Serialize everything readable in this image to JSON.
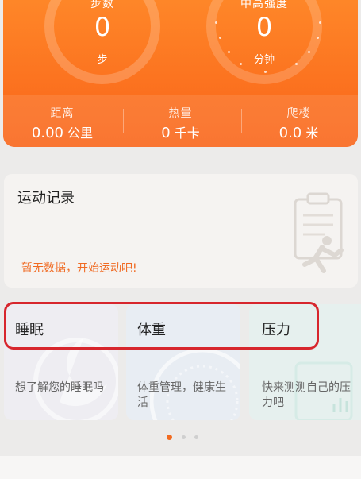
{
  "summary": {
    "steps": {
      "label": "步数",
      "value": "0",
      "unit": "步"
    },
    "intensity": {
      "label": "中高强度",
      "value": "0",
      "unit": "分钟"
    },
    "stats": [
      {
        "label": "距离",
        "value": "0.00",
        "unit": "公里"
      },
      {
        "label": "热量",
        "value": "0",
        "unit": "千卡"
      },
      {
        "label": "爬楼",
        "value": "0.0",
        "unit": "米"
      }
    ]
  },
  "record": {
    "title": "运动记录",
    "empty_text": "暂无数据，开始运动吧!"
  },
  "cards": [
    {
      "title": "睡眠",
      "desc": "想了解您的睡眠吗"
    },
    {
      "title": "体重",
      "desc": "体重管理，健康生活"
    },
    {
      "title": "压力",
      "desc": "快来测测自己的压力吧"
    }
  ],
  "pager": {
    "count": 3,
    "active": 0,
    "active_color": "#f26b21",
    "inactive_color": "#cfcfcf"
  },
  "colors": {
    "accent": "#f26b21",
    "card_bg": "#f5f3f1"
  }
}
